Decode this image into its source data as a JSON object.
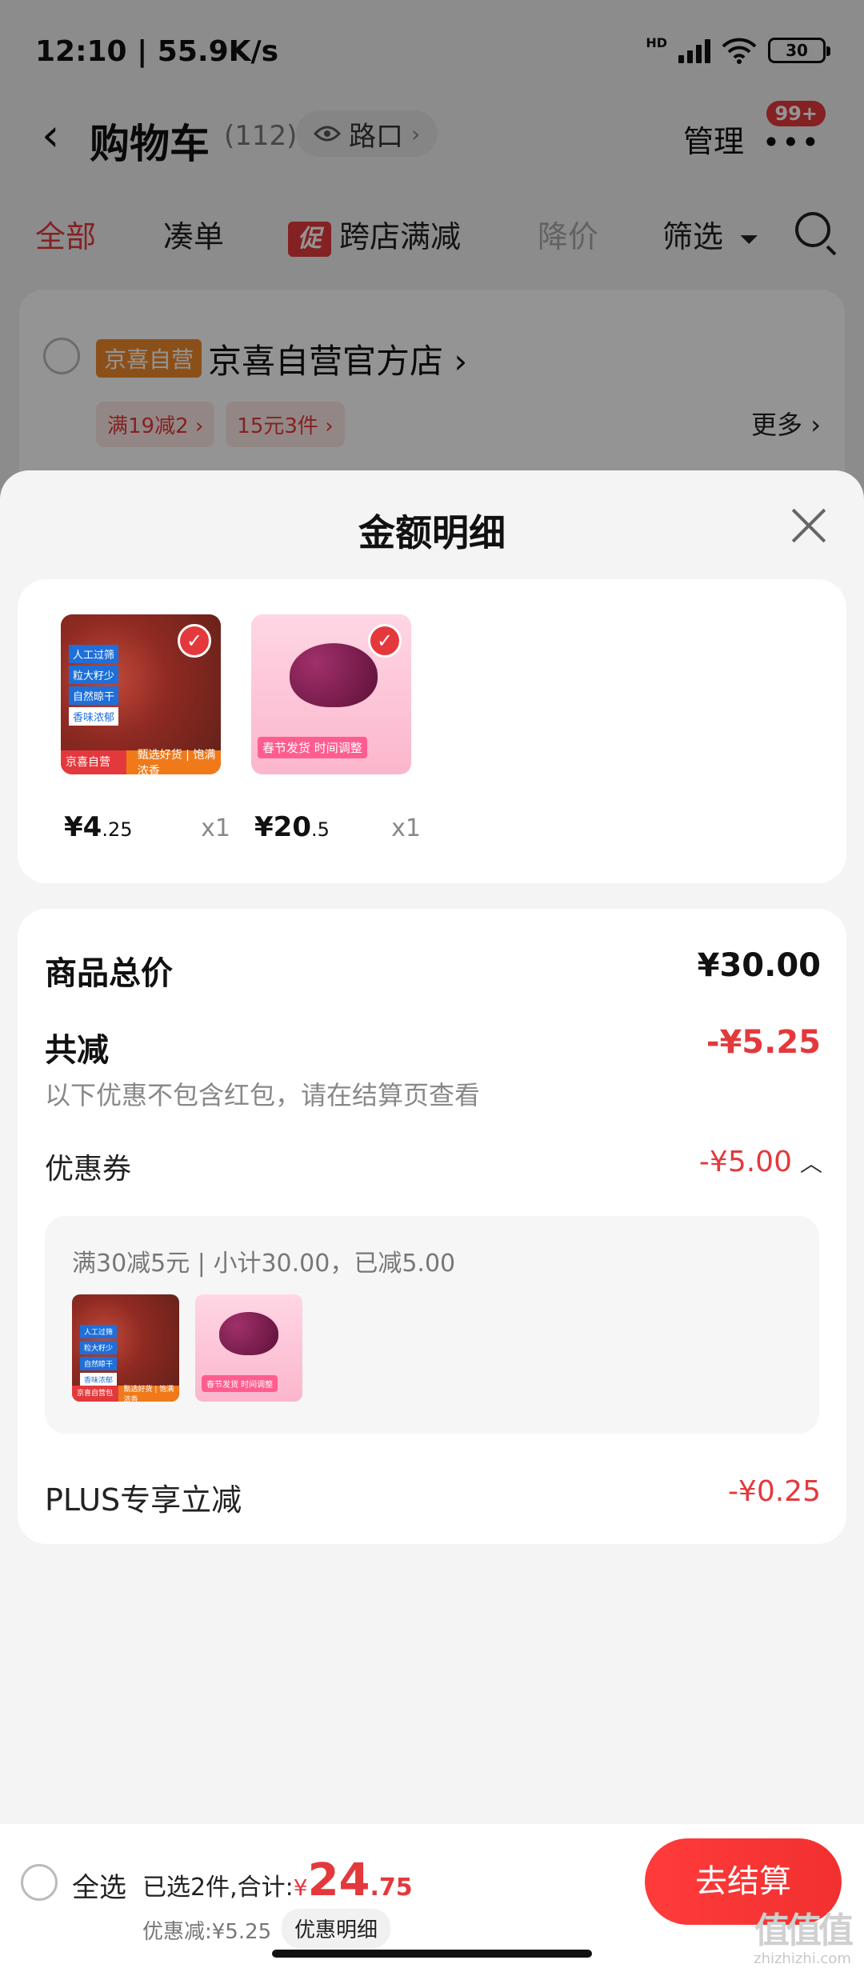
{
  "status_bar": {
    "time": "12:10 | 55.9K/s",
    "hd": "HD",
    "battery": "30"
  },
  "nav": {
    "back_icon": "‹",
    "title": "购物车",
    "count": "(112)",
    "location": "路口",
    "manage": "管理",
    "more_icon": "•••",
    "badge": "99+"
  },
  "filter_tabs": {
    "all": "全部",
    "bundle": "凑单",
    "promo_tag": "促",
    "cross_store": "跨店满减",
    "price_drop": "降价",
    "filter": "筛选"
  },
  "store": {
    "tag": "京喜自营",
    "name": "京喜自营官方店",
    "promos": [
      "满19减2 ›",
      "15元3件 ›"
    ],
    "more": "更多 ›"
  },
  "sheet": {
    "title": "金额明细",
    "products": [
      {
        "image": "sichuan-pepper-image",
        "price_int": "¥4",
        "price_dec": ".25",
        "qty": "x1",
        "image_labels": [
          "人工过筛",
          "粒大籽少",
          "自然晾干",
          "香味浓郁"
        ],
        "image_strip_tag": "京喜自营包邮",
        "image_strip": "甄选好货 | 饱满浓香"
      },
      {
        "image": "raisin-image",
        "price_int": "¥20",
        "price_dec": ".5",
        "qty": "x1",
        "image_text": "春节发货 时间调整"
      }
    ],
    "total_label": "商品总价",
    "total_value": "¥30.00",
    "discount_label": "共减",
    "discount_value": "-¥5.25",
    "discount_note": "以下优惠不包含红包，请在结算页查看",
    "coupon_label": "优惠券",
    "coupon_value": "-¥5.00",
    "coupon_desc": "满30减5元 | 小计30.00，已减5.00",
    "plus_label": "PLUS专享立减",
    "plus_value": "-¥0.25"
  },
  "bottom_bar": {
    "select_all": "全选",
    "selected_text": "已选2件,合计:",
    "currency": "¥",
    "total_int": "24",
    "total_dec": ".75",
    "saved": "优惠减:¥5.25",
    "detail_button": "优惠明细",
    "checkout": "去结算"
  },
  "watermark": {
    "big": "值值值",
    "small": "zhizhizhi.com"
  },
  "colors": {
    "accent": "#e4393c",
    "orange_tag": "#f08b2e",
    "sheet_bg": "#f4f4f4"
  }
}
